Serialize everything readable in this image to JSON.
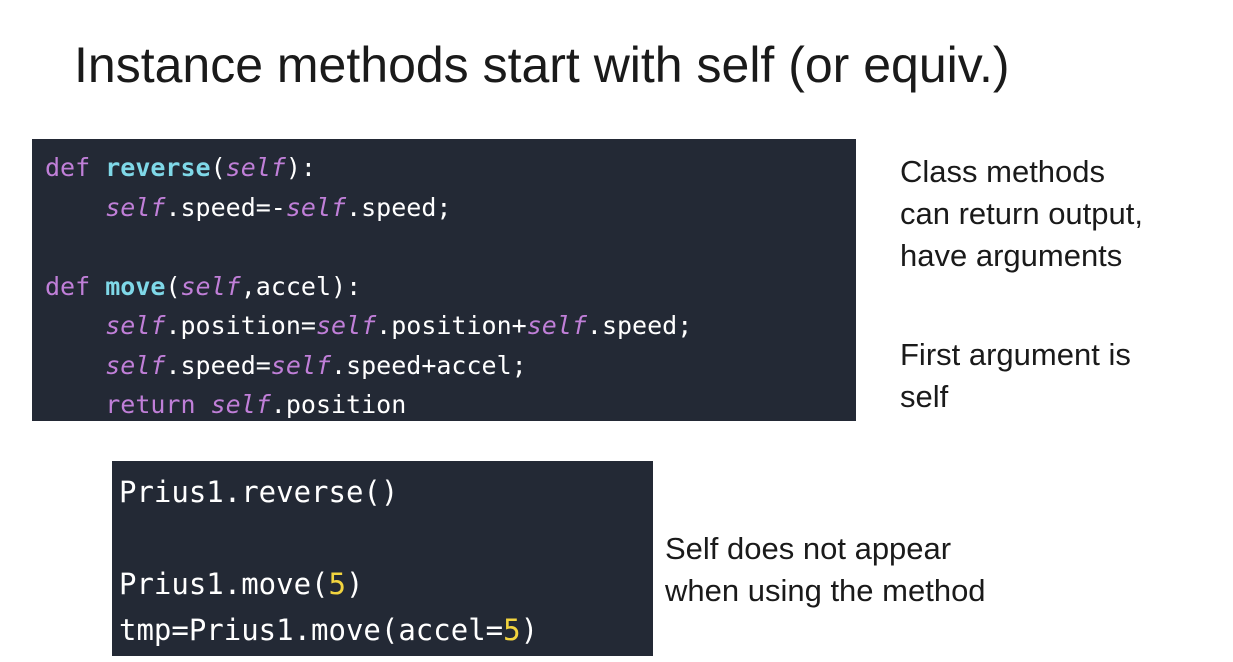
{
  "title": "Instance methods start with self (or equiv.)",
  "code_block_1": {
    "lines": [
      [
        {
          "t": "def ",
          "c": "kw"
        },
        {
          "t": "reverse",
          "c": "fn"
        },
        {
          "t": "(",
          "c": ""
        },
        {
          "t": "self",
          "c": "self"
        },
        {
          "t": "):",
          "c": ""
        }
      ],
      [
        {
          "t": "    ",
          "c": ""
        },
        {
          "t": "self",
          "c": "self"
        },
        {
          "t": ".speed=-",
          "c": ""
        },
        {
          "t": "self",
          "c": "self"
        },
        {
          "t": ".speed;",
          "c": ""
        }
      ],
      [],
      [
        {
          "t": "def ",
          "c": "kw"
        },
        {
          "t": "move",
          "c": "fn"
        },
        {
          "t": "(",
          "c": ""
        },
        {
          "t": "self",
          "c": "self"
        },
        {
          "t": ",accel):",
          "c": ""
        }
      ],
      [
        {
          "t": "    ",
          "c": ""
        },
        {
          "t": "self",
          "c": "self"
        },
        {
          "t": ".position=",
          "c": ""
        },
        {
          "t": "self",
          "c": "self"
        },
        {
          "t": ".position+",
          "c": ""
        },
        {
          "t": "self",
          "c": "self"
        },
        {
          "t": ".speed;",
          "c": ""
        }
      ],
      [
        {
          "t": "    ",
          "c": ""
        },
        {
          "t": "self",
          "c": "self"
        },
        {
          "t": ".speed=",
          "c": ""
        },
        {
          "t": "self",
          "c": "self"
        },
        {
          "t": ".speed+accel;",
          "c": ""
        }
      ],
      [
        {
          "t": "    ",
          "c": ""
        },
        {
          "t": "return ",
          "c": "kw"
        },
        {
          "t": "self",
          "c": "self"
        },
        {
          "t": ".position",
          "c": ""
        }
      ]
    ]
  },
  "code_block_2": {
    "lines": [
      [
        {
          "t": "Prius1.reverse()",
          "c": ""
        }
      ],
      [],
      [
        {
          "t": "Prius1.move(",
          "c": ""
        },
        {
          "t": "5",
          "c": "num"
        },
        {
          "t": ")",
          "c": ""
        }
      ],
      [
        {
          "t": "tmp=Prius1.move(accel=",
          "c": ""
        },
        {
          "t": "5",
          "c": "num"
        },
        {
          "t": ")",
          "c": ""
        }
      ]
    ]
  },
  "notes": {
    "note1": [
      "Class methods",
      "can return output,",
      "have arguments"
    ],
    "note2": [
      "First argument is",
      "self"
    ],
    "note3": [
      "Self does not appear",
      "when using the method"
    ]
  },
  "colors": {
    "code_background": "#232935",
    "keyword": "#c07fd8",
    "function_name": "#7fd8e8",
    "number": "#f2d43f"
  }
}
